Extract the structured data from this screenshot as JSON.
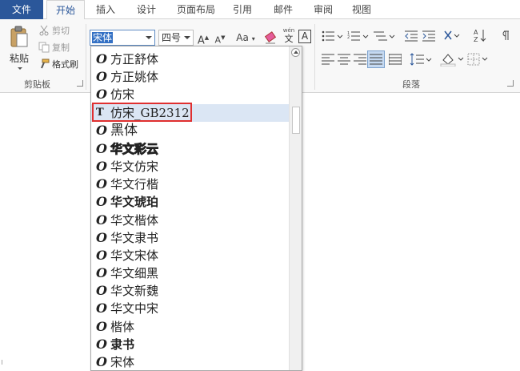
{
  "tabs": [
    {
      "label": "文件"
    },
    {
      "label": "开始"
    },
    {
      "label": "插入"
    },
    {
      "label": "设计"
    },
    {
      "label": "页面布局"
    },
    {
      "label": "引用"
    },
    {
      "label": "邮件"
    },
    {
      "label": "审阅"
    },
    {
      "label": "视图"
    }
  ],
  "clipboard": {
    "paste_label": "粘贴",
    "cut_label": "剪切",
    "copy_label": "复制",
    "format_painter_label": "格式刷",
    "group_label": "剪贴板"
  },
  "font": {
    "name_value": "宋体",
    "size_value": "四号",
    "grow_label": "A",
    "shrink_label": "A",
    "case_label": "Aa",
    "phonetic_label": "wén",
    "phonetic_char": "文",
    "border_char": "A"
  },
  "paragraph": {
    "group_label": "段落"
  },
  "font_list": [
    {
      "icon": "O",
      "name": "方正舒体"
    },
    {
      "icon": "O",
      "name": "方正姚体"
    },
    {
      "icon": "O",
      "name": "仿宋"
    },
    {
      "icon": "T",
      "name": "仿宋_GB2312"
    },
    {
      "icon": "O",
      "name": "黑体"
    },
    {
      "icon": "O",
      "name": "华文彩云"
    },
    {
      "icon": "O",
      "name": "华文仿宋"
    },
    {
      "icon": "O",
      "name": "华文行楷"
    },
    {
      "icon": "O",
      "name": "华文琥珀"
    },
    {
      "icon": "O",
      "name": "华文楷体"
    },
    {
      "icon": "O",
      "name": "华文隶书"
    },
    {
      "icon": "O",
      "name": "华文宋体"
    },
    {
      "icon": "O",
      "name": "华文细黑"
    },
    {
      "icon": "O",
      "name": "华文新魏"
    },
    {
      "icon": "O",
      "name": "华文中宋"
    },
    {
      "icon": "O",
      "name": "楷体"
    },
    {
      "icon": "O",
      "name": "隶书"
    },
    {
      "icon": "O",
      "name": "宋体"
    }
  ],
  "colors": {
    "file_tab": "#2b579a",
    "highlight_border": "#e03030",
    "selected_row": "#dbe6f4",
    "font_box_selection": "#3370c4"
  }
}
